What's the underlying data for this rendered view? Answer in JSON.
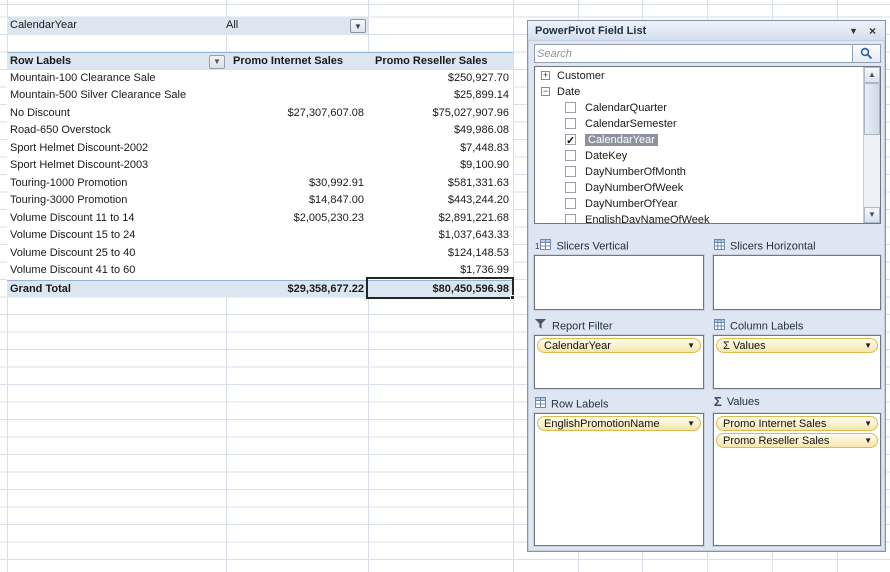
{
  "filter": {
    "label": "CalendarYear",
    "value": "All"
  },
  "pivot": {
    "columns": [
      "Row Labels",
      "Promo Internet Sales",
      "Promo Reseller Sales"
    ],
    "rows": [
      [
        "Mountain-100 Clearance Sale",
        "",
        "$250,927.70"
      ],
      [
        "Mountain-500 Silver Clearance Sale",
        "",
        "$25,899.14"
      ],
      [
        "No Discount",
        "$27,307,607.08",
        "$75,027,907.96"
      ],
      [
        "Road-650 Overstock",
        "",
        "$49,986.08"
      ],
      [
        "Sport Helmet Discount-2002",
        "",
        "$7,448.83"
      ],
      [
        "Sport Helmet Discount-2003",
        "",
        "$9,100.90"
      ],
      [
        "Touring-1000 Promotion",
        "$30,992.91",
        "$581,331.63"
      ],
      [
        "Touring-3000 Promotion",
        "$14,847.00",
        "$443,244.20"
      ],
      [
        "Volume Discount 11 to 14",
        "$2,005,230.23",
        "$2,891,221.68"
      ],
      [
        "Volume Discount 15 to 24",
        "",
        "$1,037,643.33"
      ],
      [
        "Volume Discount 25 to 40",
        "",
        "$124,148.53"
      ],
      [
        "Volume Discount 41 to 60",
        "",
        "$1,736.99"
      ]
    ],
    "grand_total": [
      "Grand Total",
      "$29,358,677.22",
      "$80,450,596.98"
    ]
  },
  "panel": {
    "title": "PowerPivot Field List",
    "search_placeholder": "Search",
    "tree": [
      {
        "kind": "table",
        "expand": "+",
        "label": "Customer",
        "checked": false,
        "selected": false
      },
      {
        "kind": "table",
        "expand": "−",
        "label": "Date",
        "checked": false,
        "selected": false
      },
      {
        "kind": "field",
        "label": "CalendarQuarter",
        "checked": false,
        "selected": false
      },
      {
        "kind": "field",
        "label": "CalendarSemester",
        "checked": false,
        "selected": false
      },
      {
        "kind": "field",
        "label": "CalendarYear",
        "checked": true,
        "selected": true
      },
      {
        "kind": "field",
        "label": "DateKey",
        "checked": false,
        "selected": false
      },
      {
        "kind": "field",
        "label": "DayNumberOfMonth",
        "checked": false,
        "selected": false
      },
      {
        "kind": "field",
        "label": "DayNumberOfWeek",
        "checked": false,
        "selected": false
      },
      {
        "kind": "field",
        "label": "DayNumberOfYear",
        "checked": false,
        "selected": false
      },
      {
        "kind": "field",
        "label": "EnglishDayNameOfWeek",
        "checked": false,
        "selected": false
      }
    ],
    "areas": {
      "slicers_vertical": {
        "label": "Slicers Vertical",
        "pills": []
      },
      "slicers_horizontal": {
        "label": "Slicers Horizontal",
        "pills": []
      },
      "report_filter": {
        "label": "Report Filter",
        "pills": [
          "CalendarYear"
        ]
      },
      "column_labels": {
        "label": "Column Labels",
        "pills": [
          "Σ Values"
        ]
      },
      "row_labels": {
        "label": "Row Labels",
        "pills": [
          "EnglishPromotionName"
        ]
      },
      "values": {
        "label": "Values",
        "pills": [
          "Promo Internet Sales",
          "Promo Reseller Sales"
        ]
      }
    }
  },
  "colors": {
    "pivot_fill": "#dce6f1",
    "pivot_border": "#95b3d7",
    "gridline": "#d9dfe9",
    "panel_bg": "#dde6f2",
    "pill_bg": "#f9edbc",
    "pill_border": "#ddba50",
    "selection_gray": "#8d939c",
    "search_icon_blue": "#2a63ad"
  }
}
